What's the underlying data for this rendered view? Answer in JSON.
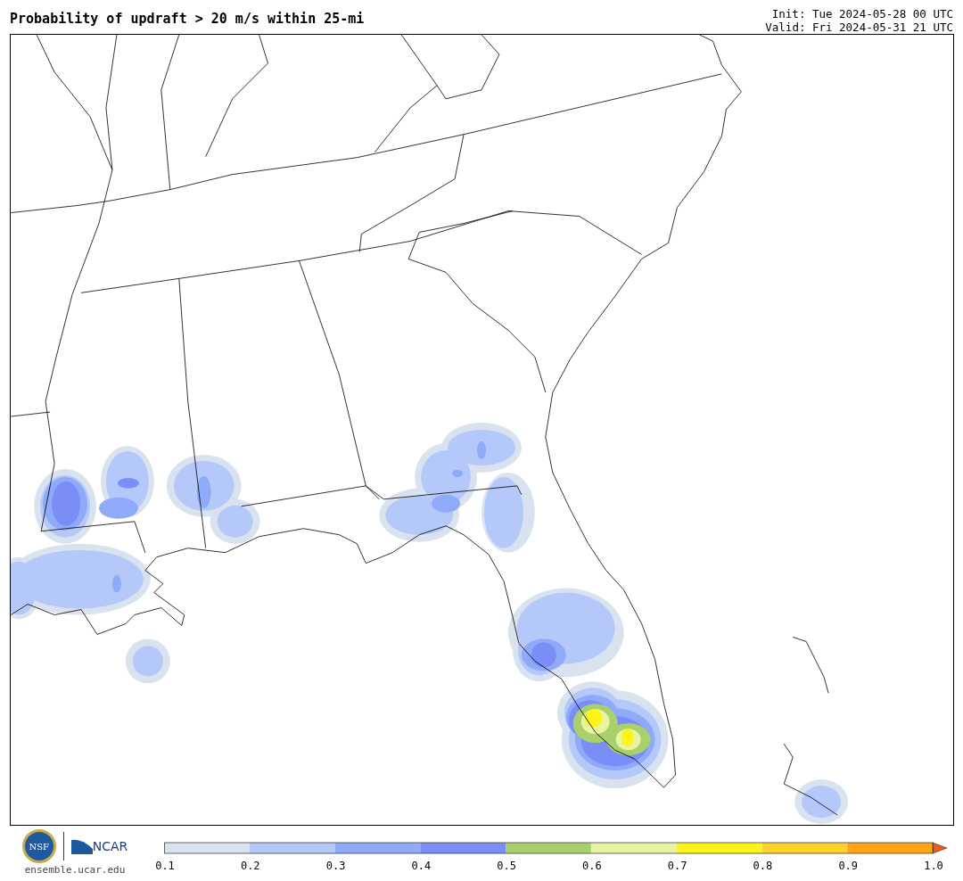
{
  "title": "Probability of updraft > 20 m/s within 25-mi",
  "init": "Init: Tue 2024-05-28 00 UTC",
  "valid": "Valid: Fri 2024-05-31 21 UTC",
  "logos": {
    "nsf": "NSF",
    "ncar": "NCAR",
    "site": "ensemble.ucar.edu"
  },
  "colorbar": {
    "bins": [
      {
        "color": "#d9e3ef"
      },
      {
        "color": "#b4c8fa"
      },
      {
        "color": "#8eaaf8"
      },
      {
        "color": "#7b8ef8"
      },
      {
        "color": "#a8d06c"
      },
      {
        "color": "#e8f4a2"
      },
      {
        "color": "#fff419"
      },
      {
        "color": "#ffd428"
      },
      {
        "color": "#ffa412"
      }
    ],
    "ticks": [
      "0.1",
      "0.2",
      "0.3",
      "0.4",
      "0.5",
      "0.6",
      "0.7",
      "0.8",
      "0.9",
      "1.0"
    ]
  }
}
